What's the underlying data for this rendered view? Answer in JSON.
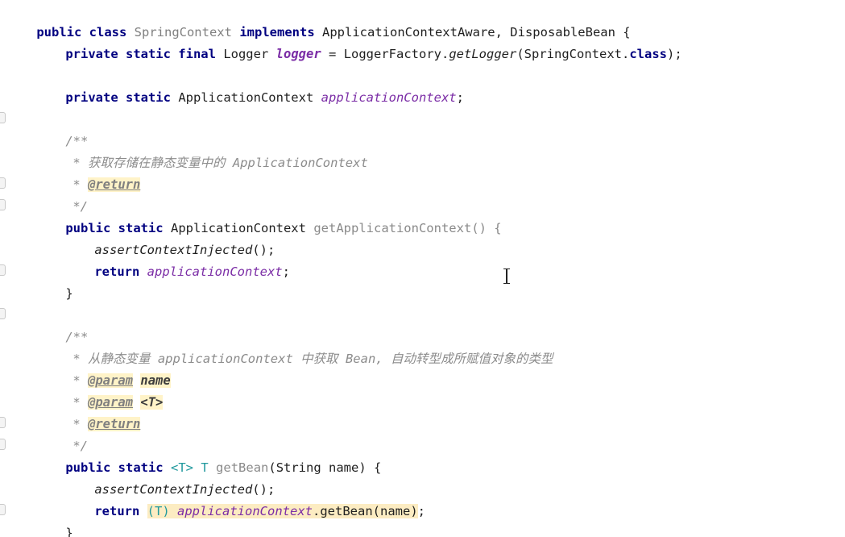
{
  "code": {
    "l1": {
      "public_class": "public class",
      "class_name": "SpringContext",
      "implements": "implements",
      "interfaces": "ApplicationContextAware, DisposableBean {"
    },
    "l2": {
      "modifiers": "private static final",
      "type": "Logger",
      "name": "logger",
      "eq": "=",
      "factory": "LoggerFactory.",
      "method": "getLogger",
      "args_open": "(SpringContext.",
      "class_kw": "class",
      "args_close": ");"
    },
    "l3": {
      "modifiers": "private static",
      "type": "ApplicationContext",
      "name": "applicationContext",
      "semi": ";"
    },
    "javadoc1": {
      "open": "/**",
      "desc": "* 获取存储在静态变量中的 ApplicationContext",
      "return_star": "*",
      "return_tag": "@return",
      "close": "*/"
    },
    "method1": {
      "modifiers": "public static",
      "return_type": "ApplicationContext",
      "name": "getApplicationContext",
      "sig_rest": "() {",
      "call": "assertContextInjected",
      "call_rest": "();",
      "return_kw": "return",
      "return_val": "applicationContext",
      "semi": ";",
      "close_brace": "}"
    },
    "javadoc2": {
      "open": "/**",
      "desc": "* 从静态变量 applicationContext 中获取 Bean, 自动转型成所赋值对象的类型",
      "param1_star": "*",
      "param1_tag": "@param",
      "param1_name": "name",
      "param2_star": "*",
      "param2_tag": "@param",
      "param2_name": "<T>",
      "return_star": "*",
      "return_tag": "@return",
      "close": "*/"
    },
    "method2": {
      "modifiers": "public static",
      "type_param": "<T>",
      "return_type": "T",
      "name": "getBean",
      "sig_rest": "(String name) {",
      "call": "assertContextInjected",
      "call_rest": "();",
      "return_kw": "return",
      "cast": "(T)",
      "target": "applicationContext",
      "dot_call": ".getBean(name)",
      "semi": ";",
      "close_brace": "}"
    }
  },
  "colors": {
    "keyword": "#000080",
    "field": "#7b2da6",
    "comment": "#8c8c8c",
    "highlight": "#fcecc2"
  }
}
